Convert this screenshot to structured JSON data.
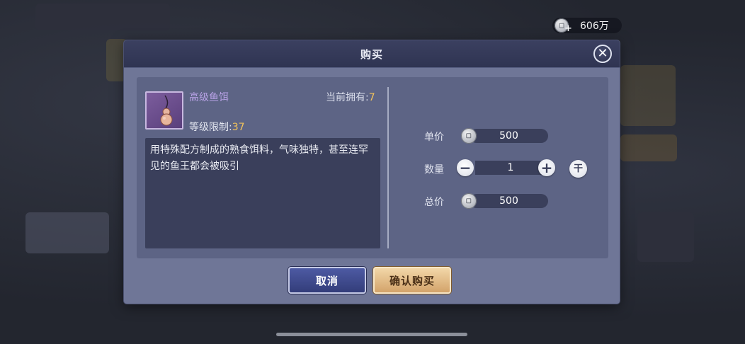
{
  "currency": {
    "value": "606万",
    "icon": "silver-coin-icon"
  },
  "dialog": {
    "title": "购买",
    "close_icon": "close-icon",
    "item": {
      "name": "高级鱼饵",
      "owned_label": "当前拥有:",
      "owned_value": "7",
      "level_label": "等级限制:",
      "level_value": "37",
      "description": "用特殊配方制成的熟食饵料，气味独特，甚至连罕见的鱼王都会被吸引",
      "icon": "gourd-bait-icon"
    },
    "unit_price": {
      "label": "单价",
      "value": "500"
    },
    "quantity": {
      "label": "数量",
      "value": "1",
      "minus": "−",
      "plus": "+",
      "max": "干"
    },
    "total_price": {
      "label": "总价",
      "value": "500"
    },
    "buttons": {
      "cancel": "取消",
      "confirm": "确认购买"
    }
  },
  "colors": {
    "item_name": "#b8a2e6",
    "highlight_number": "#f3c35a",
    "cancel_button": "#3f4a8e",
    "confirm_button": "#e2bc86"
  }
}
